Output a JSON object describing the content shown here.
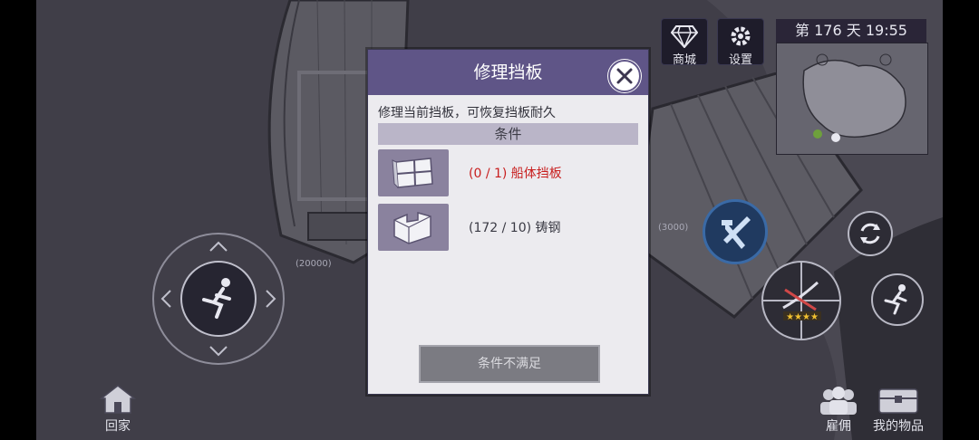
{
  "hud": {
    "shop_label": "商城",
    "settings_label": "设置",
    "day_time": "第 176 天  19:55"
  },
  "world": {
    "left_value": "(20000)",
    "right_value": "(3000)"
  },
  "modal": {
    "title": "修理挡板",
    "description": "修理当前挡板，可恢复挡板耐久",
    "conditions_header": "条件",
    "requirements": [
      {
        "text": "(0 / 1) 船体挡板",
        "color": "#c81e1e",
        "icon": "hull-panel-icon"
      },
      {
        "text": "(172 / 10) 铸钢",
        "color": "#3a3a44",
        "icon": "cast-steel-icon"
      }
    ],
    "action_label": "条件不满足"
  },
  "bottom": {
    "home_label": "回家",
    "hire_label": "雇佣",
    "items_label": "我的物品"
  },
  "colors": {
    "modal_header": "#5f5587",
    "unmet": "#c81e1e"
  }
}
